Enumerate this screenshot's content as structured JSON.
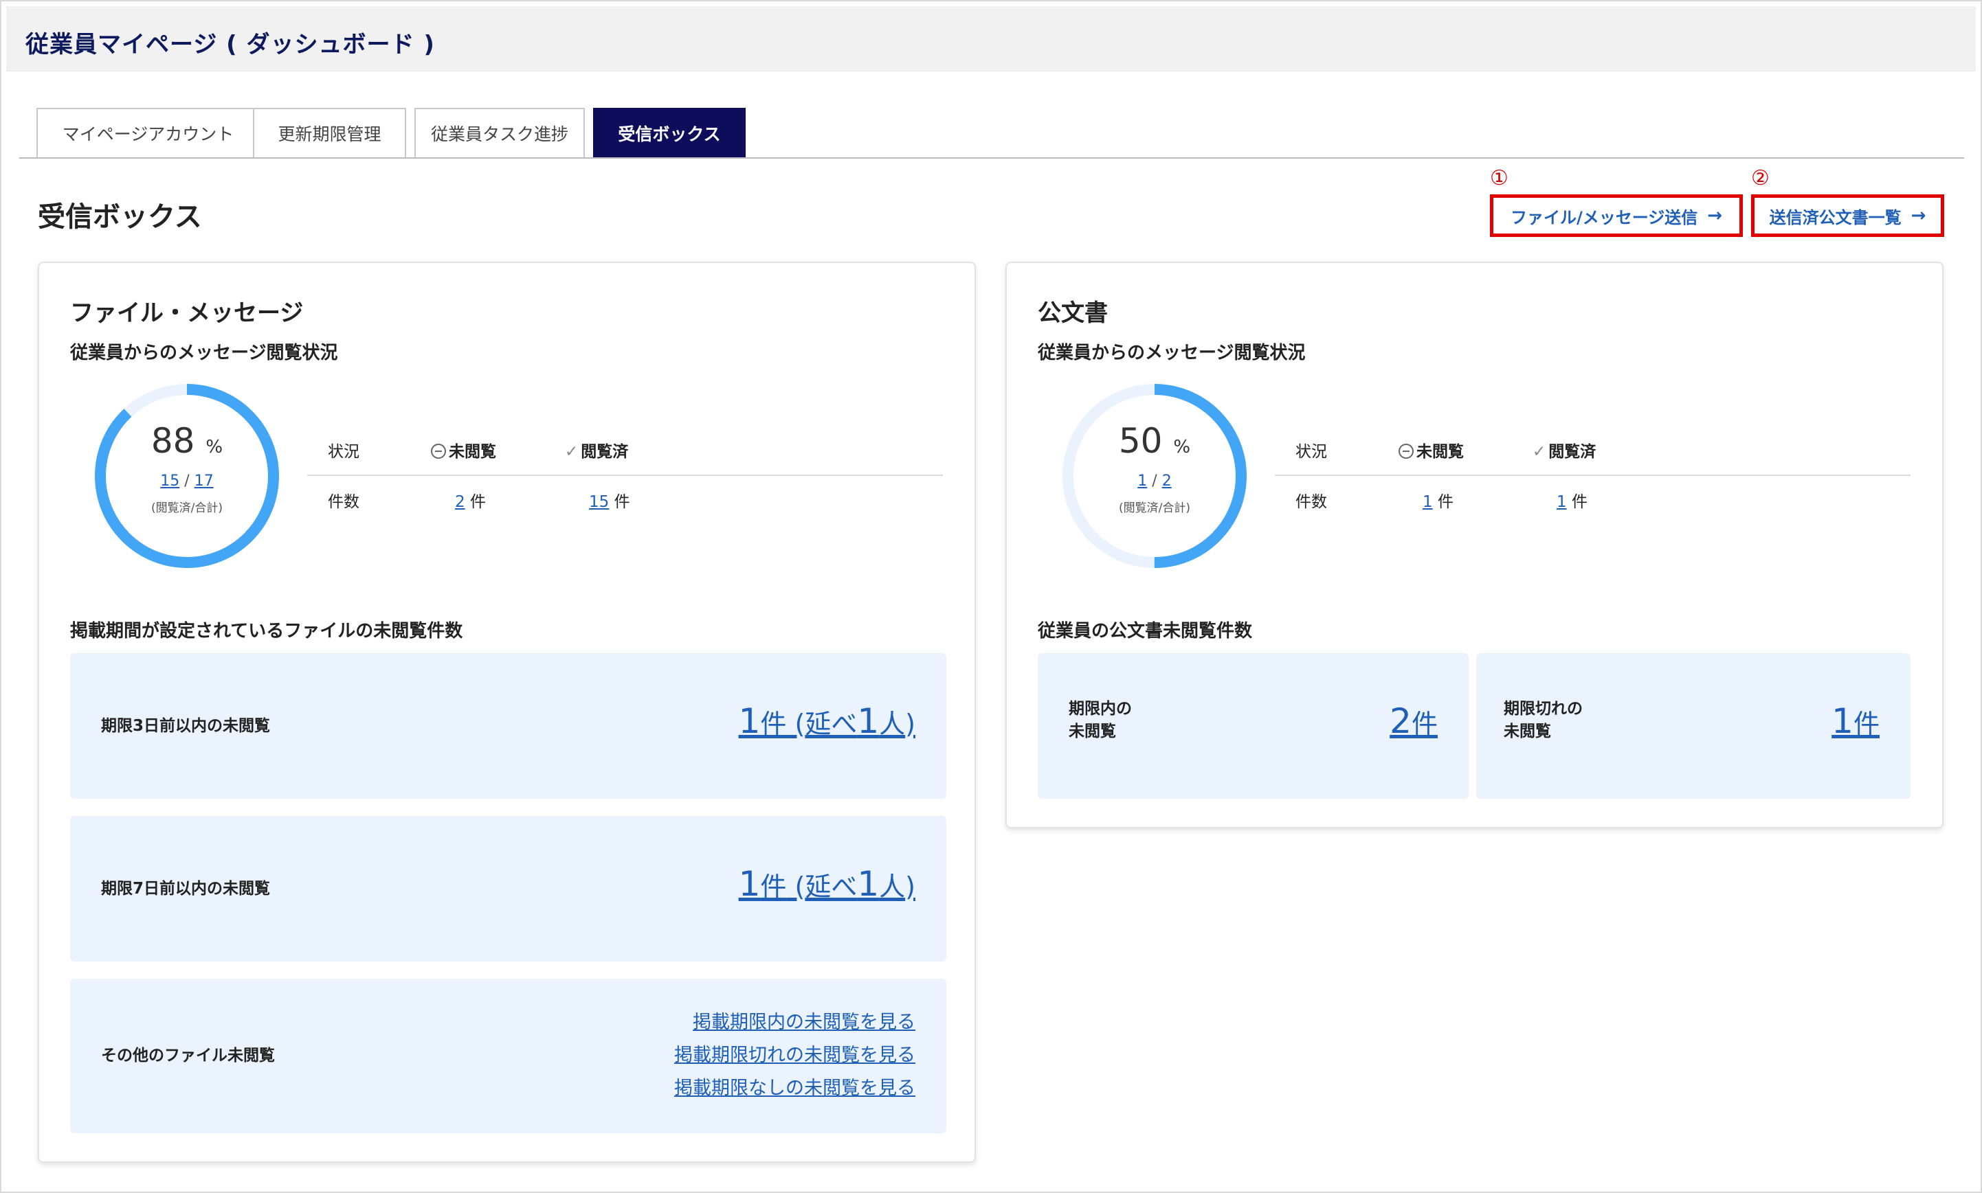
{
  "header": {
    "title": "従業員マイページ ( ダッシュボード )"
  },
  "tabs": [
    {
      "label": "マイページアカウント",
      "active": false
    },
    {
      "label": "更新期限管理",
      "active": false
    },
    {
      "label": "従業員タスク進捗",
      "active": false
    },
    {
      "label": "受信ボックス",
      "active": true
    }
  ],
  "page": {
    "title": "受信ボックス"
  },
  "actions": {
    "file_message_send": {
      "marker": "①",
      "label": "ファイル/メッセージ送信",
      "arrow": "→"
    },
    "sent_documents": {
      "marker": "②",
      "label": "送信済公文書一覧",
      "arrow": "→"
    }
  },
  "colors": {
    "accent": "#1f5fb8",
    "donut": "#42a5f5",
    "donut_track": "#eaf3fd",
    "tab_active": "#0d0d5c",
    "highlight": "#e00000",
    "box_bg": "#ebf3fe"
  },
  "file_card": {
    "title": "ファイル・メッセージ",
    "subtitle": "従業員からのメッセージ閲覧状況",
    "donut": {
      "percent": "88",
      "percent_unit": "%",
      "read": "15",
      "separator": "/",
      "total": "17",
      "note": "(閲覧済/合計)",
      "fraction": 0.88
    },
    "stats": {
      "status_label": "状況",
      "unread_label": "未閲覧",
      "read_label": "閲覧済",
      "count_label": "件数",
      "unread_count": "2",
      "read_count": "15",
      "unit": "件"
    },
    "deadline_heading": "掲載期間が設定されているファイルの未閲覧件数",
    "boxes": [
      {
        "label": "期限3日前以内の未閲覧",
        "count": "1",
        "unit": "件",
        "paren_open": " (",
        "extra_label": "延べ",
        "extra_count": "1",
        "extra_unit": "人",
        "paren_close": ")"
      },
      {
        "label": "期限7日前以内の未閲覧",
        "count": "1",
        "unit": "件",
        "paren_open": " (",
        "extra_label": "延べ",
        "extra_count": "1",
        "extra_unit": "人",
        "paren_close": ")"
      }
    ],
    "other": {
      "label": "その他のファイル未閲覧",
      "links": [
        "掲載期限内の未閲覧を見る",
        "掲載期限切れの未閲覧を見る",
        "掲載期限なしの未閲覧を見る"
      ]
    }
  },
  "doc_card": {
    "title": "公文書",
    "subtitle": "従業員からのメッセージ閲覧状況",
    "donut": {
      "percent": "50",
      "percent_unit": "%",
      "read": "1",
      "separator": "/",
      "total": "2",
      "note": "(閲覧済/合計)",
      "fraction": 0.5
    },
    "stats": {
      "status_label": "状況",
      "unread_label": "未閲覧",
      "read_label": "閲覧済",
      "count_label": "件数",
      "unread_count": "1",
      "read_count": "1",
      "unit": "件"
    },
    "unread_heading": "従業員の公文書未閲覧件数",
    "boxes": [
      {
        "label_line1": "期限内の",
        "label_line2": "未閲覧",
        "count": "2",
        "unit": "件"
      },
      {
        "label_line1": "期限切れの",
        "label_line2": "未閲覧",
        "count": "1",
        "unit": "件"
      }
    ]
  }
}
